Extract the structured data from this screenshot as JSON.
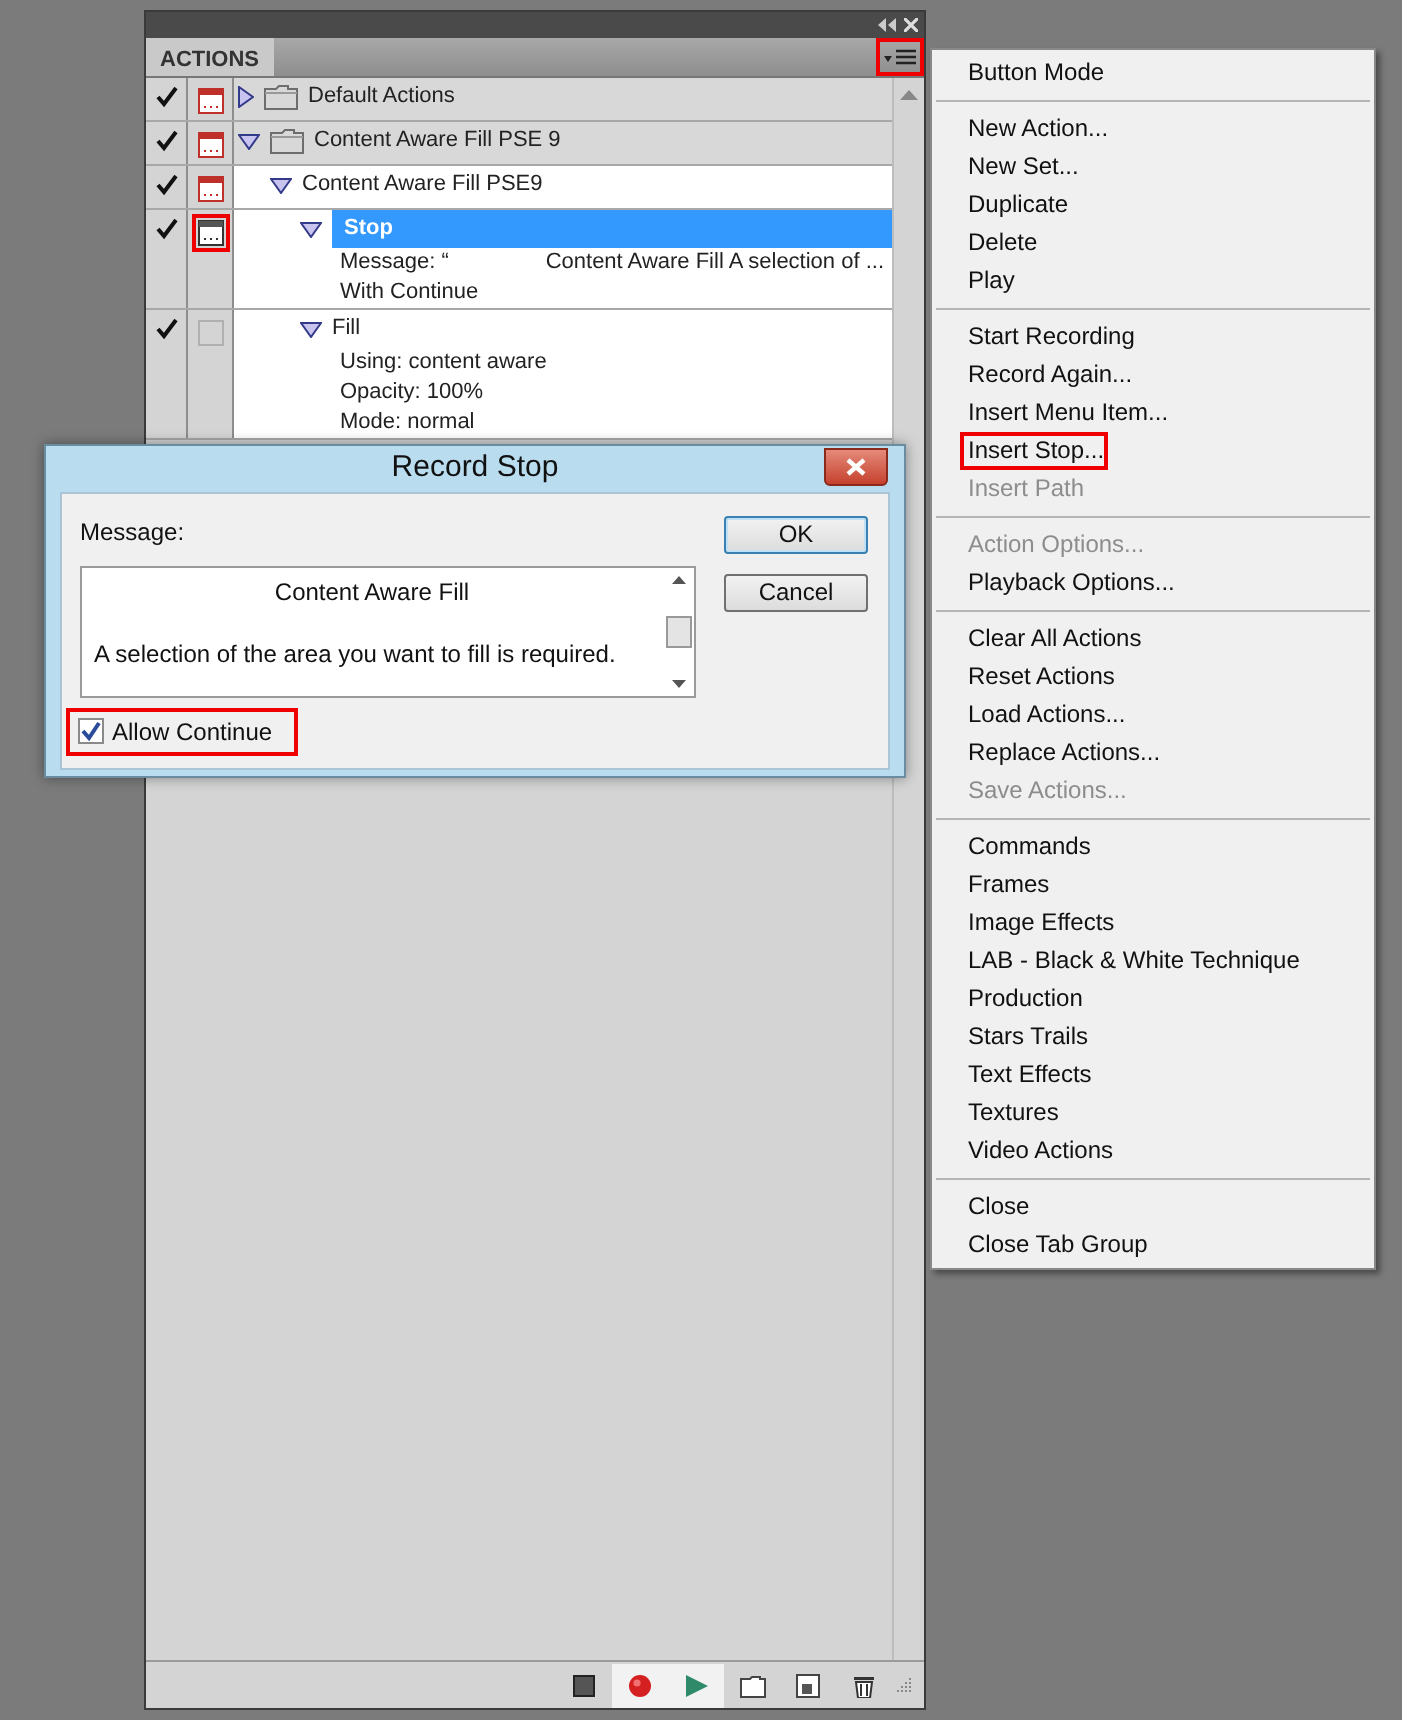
{
  "panel": {
    "tab": "ACTIONS",
    "menu_button_highlighted": true,
    "sets": [
      {
        "kind": "set",
        "label": "Default Actions",
        "checked": true,
        "dialog_on": true,
        "dialog_mixed": true,
        "dialog_highlighted": false,
        "expanded": false,
        "selected": false
      },
      {
        "kind": "set",
        "label": "Content Aware Fill PSE 9",
        "checked": true,
        "dialog_on": true,
        "dialog_mixed": true,
        "dialog_highlighted": false,
        "expanded": true,
        "selected": false,
        "children": [
          {
            "kind": "action",
            "label": "Content Aware Fill PSE9",
            "checked": true,
            "dialog_on": true,
            "dialog_mixed": true,
            "dialog_highlighted": false,
            "expanded": true,
            "selected": false,
            "children": [
              {
                "kind": "step",
                "label": "Stop",
                "checked": true,
                "dialog_on": true,
                "dialog_mixed": false,
                "dialog_highlighted": true,
                "expanded": true,
                "selected": true,
                "details": [
                  [
                    "Message:  “",
                    "Content Aware Fill  A selection of ..."
                  ],
                  [
                    "With Continue"
                  ]
                ]
              },
              {
                "kind": "step",
                "label": "Fill",
                "checked": true,
                "dialog_on": false,
                "dialog_mixed": false,
                "dialog_highlighted": false,
                "expanded": true,
                "selected": false,
                "details": [
                  [
                    "Using: content aware"
                  ],
                  [
                    "Opacity: 100%"
                  ],
                  [
                    "Mode: normal"
                  ]
                ]
              }
            ]
          }
        ]
      }
    ]
  },
  "menu": {
    "sections": [
      [
        {
          "label": "Button Mode",
          "disabled": false,
          "highlighted": false
        }
      ],
      [
        {
          "label": "New Action...",
          "disabled": false,
          "highlighted": false
        },
        {
          "label": "New Set...",
          "disabled": false,
          "highlighted": false
        },
        {
          "label": "Duplicate",
          "disabled": false,
          "highlighted": false
        },
        {
          "label": "Delete",
          "disabled": false,
          "highlighted": false
        },
        {
          "label": "Play",
          "disabled": false,
          "highlighted": false
        }
      ],
      [
        {
          "label": "Start Recording",
          "disabled": false,
          "highlighted": false
        },
        {
          "label": "Record Again...",
          "disabled": false,
          "highlighted": false
        },
        {
          "label": "Insert Menu Item...",
          "disabled": false,
          "highlighted": false
        },
        {
          "label": "Insert Stop...",
          "disabled": false,
          "highlighted": true
        },
        {
          "label": "Insert Path",
          "disabled": true,
          "highlighted": false
        }
      ],
      [
        {
          "label": "Action Options...",
          "disabled": true,
          "highlighted": false
        },
        {
          "label": "Playback Options...",
          "disabled": false,
          "highlighted": false
        }
      ],
      [
        {
          "label": "Clear All Actions",
          "disabled": false,
          "highlighted": false
        },
        {
          "label": "Reset Actions",
          "disabled": false,
          "highlighted": false
        },
        {
          "label": "Load Actions...",
          "disabled": false,
          "highlighted": false
        },
        {
          "label": "Replace Actions...",
          "disabled": false,
          "highlighted": false
        },
        {
          "label": "Save Actions...",
          "disabled": true,
          "highlighted": false
        }
      ],
      [
        {
          "label": "Commands",
          "disabled": false,
          "highlighted": false
        },
        {
          "label": "Frames",
          "disabled": false,
          "highlighted": false
        },
        {
          "label": "Image Effects",
          "disabled": false,
          "highlighted": false
        },
        {
          "label": "LAB - Black & White Technique",
          "disabled": false,
          "highlighted": false
        },
        {
          "label": "Production",
          "disabled": false,
          "highlighted": false
        },
        {
          "label": "Stars Trails",
          "disabled": false,
          "highlighted": false
        },
        {
          "label": "Text Effects",
          "disabled": false,
          "highlighted": false
        },
        {
          "label": "Textures",
          "disabled": false,
          "highlighted": false
        },
        {
          "label": "Video Actions",
          "disabled": false,
          "highlighted": false
        }
      ],
      [
        {
          "label": "Close",
          "disabled": false,
          "highlighted": false
        },
        {
          "label": "Close Tab Group",
          "disabled": false,
          "highlighted": false
        }
      ]
    ]
  },
  "dialog": {
    "title": "Record Stop",
    "message_label": "Message:",
    "message_lines": [
      "Content Aware Fill",
      "A selection of the area you want to fill is required."
    ],
    "buttons": [
      {
        "label": "OK",
        "default": true
      },
      {
        "label": "Cancel",
        "default": false
      }
    ],
    "allow_continue": {
      "label": "Allow Continue",
      "checked": true,
      "highlighted": true
    }
  }
}
